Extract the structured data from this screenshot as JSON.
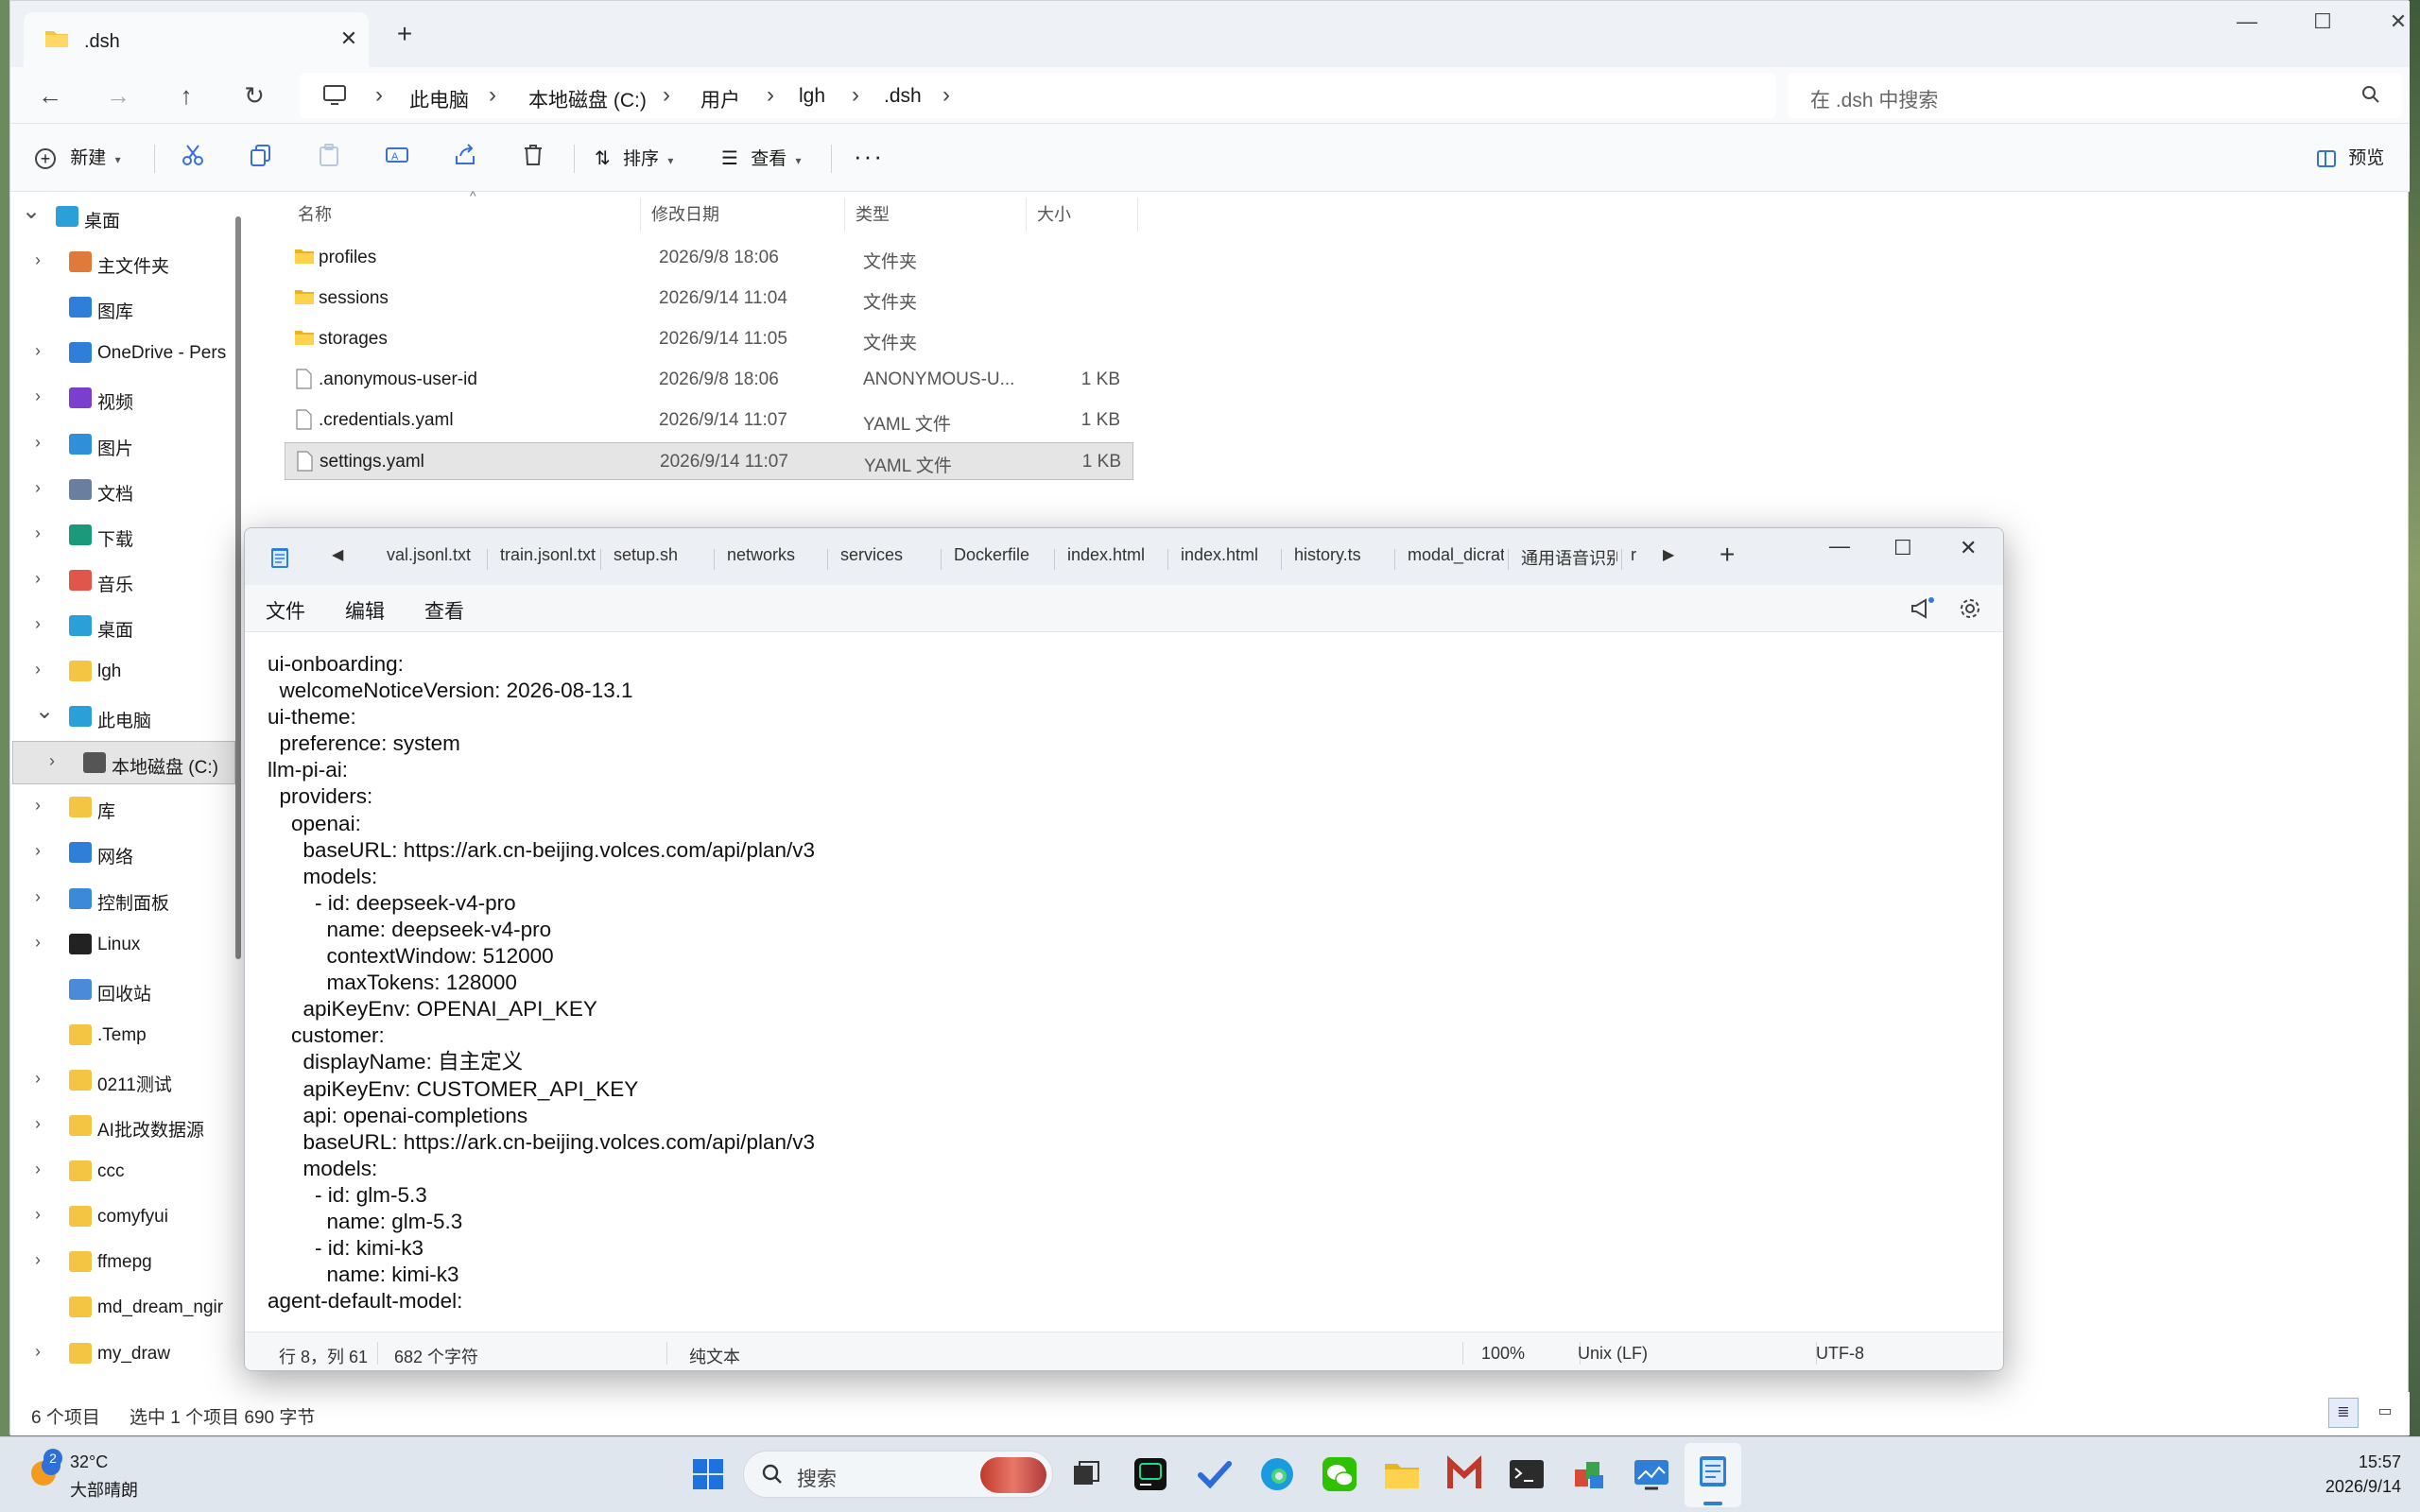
{
  "explorer": {
    "tab_title": ".dsh",
    "address": {
      "crumbs": [
        "此电脑",
        "本地磁盘 (C:)",
        "用户",
        "lgh",
        ".dsh"
      ]
    },
    "search_placeholder": "在 .dsh 中搜索",
    "toolbar": {
      "new_label": "新建",
      "sort_label": "排序",
      "view_label": "查看",
      "preview_label": "预览"
    },
    "sidebar": {
      "items": [
        {
          "label": "桌面",
          "icon": "desktop-icon"
        },
        {
          "label": "主文件夹",
          "icon": "home-icon"
        },
        {
          "label": "图库",
          "icon": "gallery-icon"
        },
        {
          "label": "OneDrive - Pers",
          "icon": "onedrive-icon"
        },
        {
          "label": "视频",
          "icon": "video-icon"
        },
        {
          "label": "图片",
          "icon": "pictures-icon"
        },
        {
          "label": "文档",
          "icon": "documents-icon"
        },
        {
          "label": "下载",
          "icon": "download-icon"
        },
        {
          "label": "音乐",
          "icon": "music-icon"
        },
        {
          "label": "桌面",
          "icon": "desktop-icon"
        },
        {
          "label": "lgh",
          "icon": "folder-icon"
        },
        {
          "label": "此电脑",
          "icon": "computer-icon"
        },
        {
          "label": "本地磁盘 (C:)",
          "icon": "drive-icon"
        },
        {
          "label": "库",
          "icon": "folder-icon"
        },
        {
          "label": "网络",
          "icon": "network-icon"
        },
        {
          "label": "控制面板",
          "icon": "control-panel-icon"
        },
        {
          "label": "Linux",
          "icon": "linux-icon"
        },
        {
          "label": "回收站",
          "icon": "recycle-bin-icon"
        },
        {
          "label": ".Temp",
          "icon": "folder-icon"
        },
        {
          "label": "0211测试",
          "icon": "folder-icon"
        },
        {
          "label": "AI批改数据源",
          "icon": "folder-icon"
        },
        {
          "label": "ccc",
          "icon": "folder-icon"
        },
        {
          "label": "comyfyui",
          "icon": "folder-icon"
        },
        {
          "label": "ffmepg",
          "icon": "folder-icon"
        },
        {
          "label": "md_dream_ngir",
          "icon": "folder-icon"
        },
        {
          "label": "my_draw",
          "icon": "folder-icon"
        }
      ]
    },
    "columns": {
      "name": "名称",
      "date": "修改日期",
      "type": "类型",
      "size": "大小"
    },
    "files": [
      {
        "name": "profiles",
        "date": "2026/9/8 18:06",
        "type": "文件夹",
        "size": "",
        "kind": "folder"
      },
      {
        "name": "sessions",
        "date": "2026/9/14 11:04",
        "type": "文件夹",
        "size": "",
        "kind": "folder"
      },
      {
        "name": "storages",
        "date": "2026/9/14 11:05",
        "type": "文件夹",
        "size": "",
        "kind": "folder"
      },
      {
        "name": ".anonymous-user-id",
        "date": "2026/9/8 18:06",
        "type": "ANONYMOUS-U...",
        "size": "1 KB",
        "kind": "file"
      },
      {
        "name": ".credentials.yaml",
        "date": "2026/9/14 11:07",
        "type": "YAML 文件",
        "size": "1 KB",
        "kind": "file"
      },
      {
        "name": "settings.yaml",
        "date": "2026/9/14 11:07",
        "type": "YAML 文件",
        "size": "1 KB",
        "kind": "file"
      }
    ],
    "status": {
      "count": "6 个项目",
      "selection": "选中 1 个项目  690 字节"
    }
  },
  "notepad": {
    "tabs": [
      "val.jsonl.txt",
      "train.jsonl.txt",
      "setup.sh",
      "networks",
      "services",
      "Dockerfile",
      "index.html",
      "index.html",
      "history.ts",
      "modal_dicrat",
      "通用语音识别",
      "r"
    ],
    "menu": {
      "file": "文件",
      "edit": "编辑",
      "view": "查看"
    },
    "content": "ui-onboarding:\n  welcomeNoticeVersion: 2026-08-13.1\nui-theme:\n  preference: system\nllm-pi-ai:\n  providers:\n    openai:\n      baseURL: https://ark.cn-beijing.volces.com/api/plan/v3\n      models:\n        - id: deepseek-v4-pro\n          name: deepseek-v4-pro\n          contextWindow: 512000\n          maxTokens: 128000\n      apiKeyEnv: OPENAI_API_KEY\n    customer:\n      displayName: 自主定义\n      apiKeyEnv: CUSTOMER_API_KEY\n      api: openai-completions\n      baseURL: https://ark.cn-beijing.volces.com/api/plan/v3\n      models:\n        - id: glm-5.3\n          name: glm-5.3\n        - id: kimi-k3\n          name: kimi-k3\nagent-default-model:",
    "status": {
      "position": "行 8，列 61",
      "chars": "682 个字符",
      "format": "纯文本",
      "zoom": "100%",
      "line_ending": "Unix (LF)",
      "encoding": "UTF-8"
    }
  },
  "taskbar": {
    "weather_badge": "2",
    "temperature": "32°C",
    "weather": "大部晴朗",
    "search_label": "搜索",
    "time": "15:57",
    "date": "2026/9/14"
  }
}
